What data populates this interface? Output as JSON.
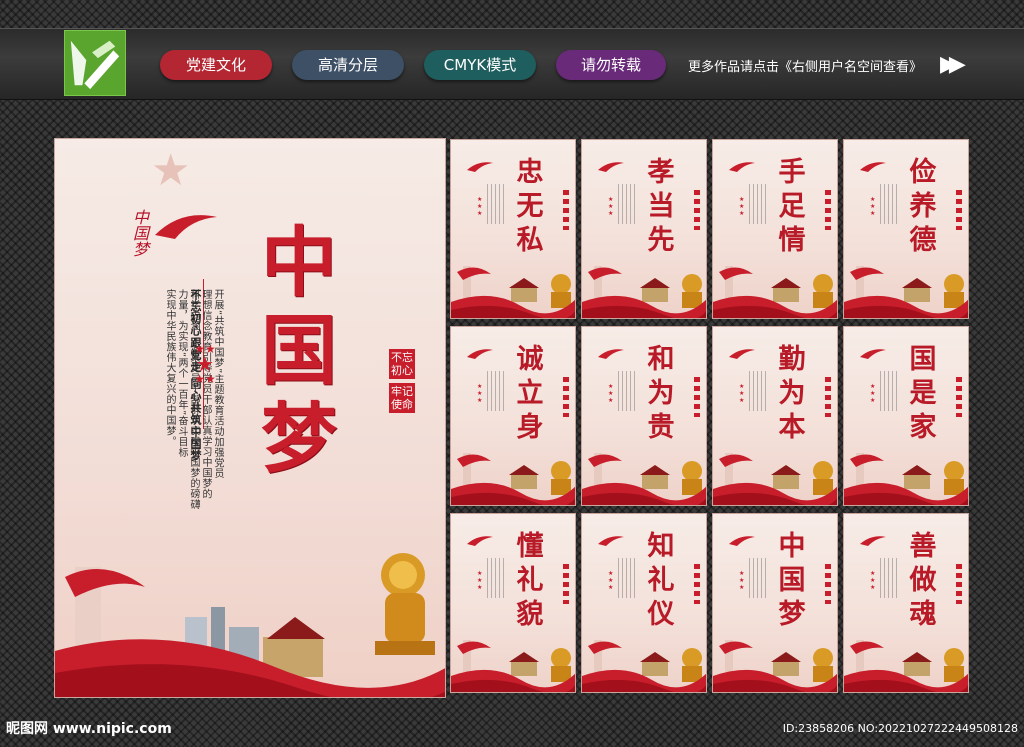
{
  "toolbar": {
    "tags": [
      "党建文化",
      "高清分层",
      "CMYK模式",
      "请勿转载"
    ],
    "note": "更多作品请点击《右侧用户名空间查看》",
    "arrow": "▶▶"
  },
  "main_poster": {
    "brand": "中国梦",
    "title": "中国梦",
    "slogan_main": "不忘初心跟党走 同心共筑中国梦",
    "body_lines": [
      "开展“共筑中国梦”主题教育活动加强党员",
      "理想信念教育引导党员干部认真学习中国梦的",
      "科学内涵，汇集党员干部群众实现中国梦的磅礴",
      "力量，为实现“两个一百年”奋斗目标",
      "实现中华民族伟大复兴的中国梦。"
    ],
    "badge_lines": [
      "不忘初心",
      "牢记使命"
    ]
  },
  "small_posters": [
    {
      "title": "忠无私"
    },
    {
      "title": "孝当先"
    },
    {
      "title": "手足情"
    },
    {
      "title": "俭养德"
    },
    {
      "title": "诚立身"
    },
    {
      "title": "和为贵"
    },
    {
      "title": "勤为本"
    },
    {
      "title": "国是家"
    },
    {
      "title": "懂礼貌"
    },
    {
      "title": "知礼仪"
    },
    {
      "title": "中国梦"
    },
    {
      "title": "善做魂"
    }
  ],
  "footer": {
    "site": "昵图网 www.nipic.com",
    "id": "ID:23858206 NO:20221027222449508128"
  },
  "colors": {
    "accent_red": "#c81e2b",
    "logo_green": "#5aa52e"
  }
}
